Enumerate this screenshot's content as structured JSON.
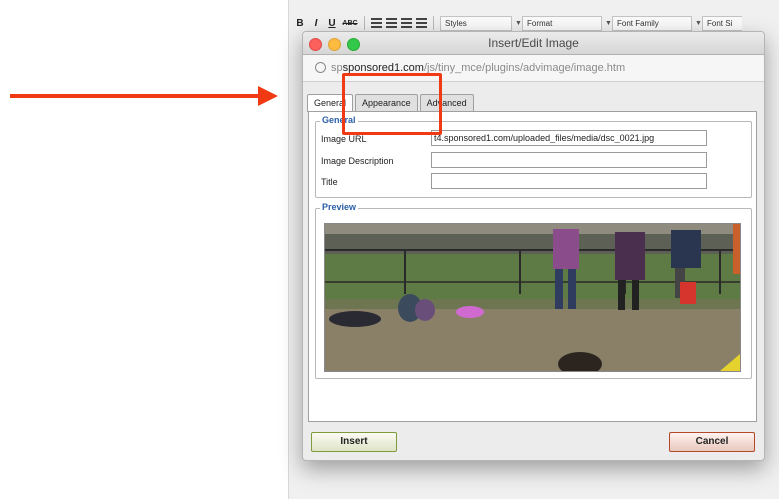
{
  "editor": {
    "toolbar": {
      "bold": "B",
      "italic": "I",
      "underline": "U",
      "strikethrough": "ABC",
      "styles": "Styles",
      "format": "Format",
      "font_family": "Font Family",
      "font_size": "Font Si"
    }
  },
  "dialog": {
    "title": "Insert/Edit Image",
    "url_prefix": "sp",
    "url_domain": "sponsored1.com",
    "url_path": "/js/tiny_mce/plugins/advimage/image.htm",
    "tabs": [
      {
        "label": "General",
        "active": true
      },
      {
        "label": "Appearance",
        "active": false
      },
      {
        "label": "Advanced",
        "active": false
      }
    ],
    "general": {
      "legend": "General",
      "image_url_label": "Image URL",
      "image_url_value": "t4.sponsored1.com/uploaded_files/media/dsc_0021.jpg",
      "image_description_label": "Image Description",
      "image_description_value": "",
      "title_label": "Title",
      "title_value": ""
    },
    "preview": {
      "legend": "Preview"
    },
    "buttons": {
      "insert": "Insert",
      "cancel": "Cancel"
    }
  },
  "annotation": {
    "arrow_color": "#f13a13",
    "highlight_target": "Appearance tab"
  }
}
